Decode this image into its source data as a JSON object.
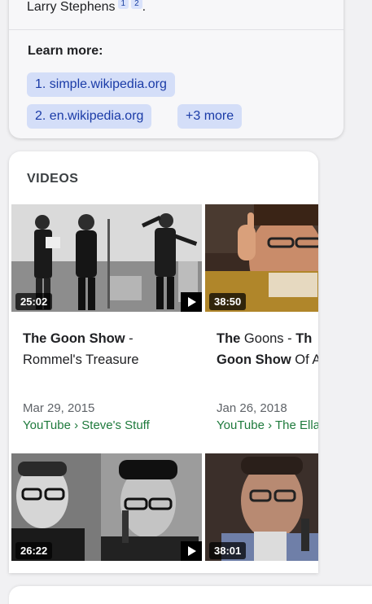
{
  "top_card": {
    "citation_text": "Larry Stephens",
    "citation_refs": [
      "1",
      "2"
    ],
    "citation_tail": ".",
    "learn_more_title": "Learn more:",
    "chips": [
      {
        "label": "1. simple.wikipedia.org"
      },
      {
        "label": "2. en.wikipedia.org"
      },
      {
        "label": "+3 more"
      }
    ]
  },
  "videos": {
    "header": "VIDEOS",
    "items": [
      {
        "title_bold": "The Goon Show",
        "title_rest": " -",
        "title_line2": "Rommel's Treasure",
        "duration": "25:02",
        "date": "Mar 29, 2015",
        "source": "YouTube › Steve's Stuff"
      },
      {
        "title_bold": "The",
        "title_rest": " Goons - ",
        "title_bold2": "Th",
        "title_line2_bold": "Goon Show",
        "title_line2": " Of A",
        "duration": "38:50",
        "date": "Jan 26, 2018",
        "source": "YouTube › The Ella"
      },
      {
        "duration": "26:22"
      },
      {
        "duration": "38:01"
      }
    ]
  }
}
